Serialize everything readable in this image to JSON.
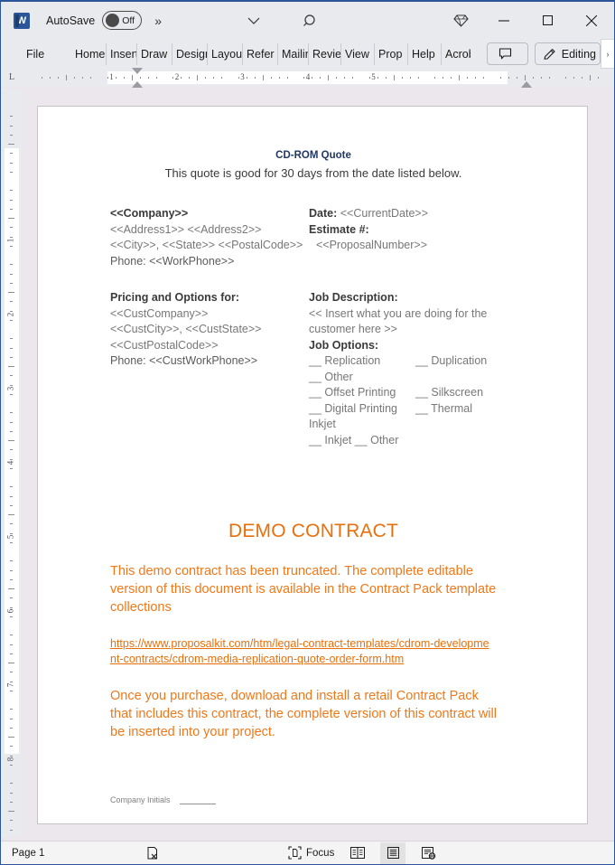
{
  "titlebar": {
    "app_icon": "word-logo-icon",
    "autosave_label": "AutoSave",
    "autosave_state": "Off",
    "qat_overflow": "»",
    "chevron": "⌄",
    "search_icon": "search-icon",
    "diamond_icon": "diamond-icon",
    "minimize": "─",
    "maximize": "☐",
    "close": "✕"
  },
  "ribbon": {
    "tabs": [
      {
        "label": "File"
      },
      {
        "label": "Home"
      },
      {
        "label": "Insert"
      },
      {
        "label": "Draw"
      },
      {
        "label": "Design"
      },
      {
        "label": "Layout"
      },
      {
        "label": "Refer"
      },
      {
        "label": "Mailings"
      },
      {
        "label": "Review"
      },
      {
        "label": "View"
      },
      {
        "label": "Prop"
      },
      {
        "label": "Help"
      },
      {
        "label": "Acrobat"
      }
    ],
    "comment_button": "",
    "editing_button": "Editing",
    "expand_chevron": "›"
  },
  "ruler": {
    "corner_marker": "L",
    "h_numbers": [
      1,
      2,
      3,
      4,
      5
    ],
    "v_numbers": [
      1,
      2,
      3,
      4,
      5,
      6,
      7,
      8
    ]
  },
  "document": {
    "title": "CD-ROM Quote",
    "subtitle": "This quote is good for 30 days from the date listed below.",
    "company_block": {
      "company": "<<Company>>",
      "address": "<<Address1>> <<Address2>>",
      "city_state_zip": "<<City>>, <<State>> <<PostalCode>>",
      "phone": "Phone: <<WorkPhone>>"
    },
    "date_block": {
      "date_label": "Date:",
      "date_value": "<<CurrentDate>>",
      "estimate_label": "Estimate #:",
      "estimate_value": "<<ProposalNumber>>"
    },
    "pricing_block": {
      "heading": "Pricing and Options for:",
      "cust_company": "<<CustCompany>>",
      "cust_city_state": "<<CustCity>>, <<CustState>>",
      "cust_postal": "<<CustPostalCode>>",
      "cust_phone": "Phone: <<CustWorkPhone>>"
    },
    "job_block": {
      "desc_heading": "Job Description:",
      "desc_line1": "<< Insert what you are doing for the",
      "desc_line2": "customer here >>",
      "options_heading": "Job Options:",
      "options_rows": [
        {
          "a": "__  Replication",
          "b": "__ Duplication"
        },
        {
          "a": "__ Other",
          "b": ""
        },
        {
          "a": "__ Offset Printing",
          "b": "__ Silkscreen"
        },
        {
          "a": "__  Digital Printing",
          "b": "__ Thermal"
        },
        {
          "a": "Inkjet",
          "b": ""
        },
        {
          "a": "__ Inkjet __ Other",
          "b": ""
        }
      ]
    },
    "demo_heading": "DEMO CONTRACT",
    "demo_para1": "This demo contract has been truncated. The complete editable version of this document is available in the Contract Pack template collections",
    "demo_link": "https://www.proposalkit.com/htm/legal-contract-templates/cdrom-development-contracts/cdrom-media-replication-quote-order-form.htm",
    "demo_para2": "Once you purchase, download and install a retail Contract Pack that includes this contract, the complete version of this contract will be inserted into your project.",
    "initials_label": "Company Initials"
  },
  "statusbar": {
    "page": "Page 1",
    "proofing_icon": "proofing-errors-icon",
    "focus_label": "Focus",
    "focus_icon": "focus-icon",
    "view_read_icon": "read-mode-icon",
    "view_print_icon": "print-layout-icon",
    "view_web_icon": "web-layout-icon"
  },
  "colors": {
    "accent_orange": "#f07818",
    "title_navy": "#1f3864",
    "word_blue": "#2b579a",
    "canvas_bg": "#ece7ec"
  }
}
